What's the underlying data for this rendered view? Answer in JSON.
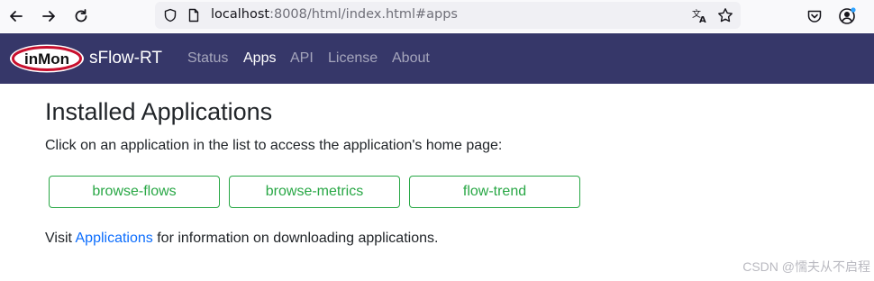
{
  "browser": {
    "url_host": "localhost",
    "url_rest": ":8008/html/index.html#apps",
    "icons": [
      "back-arrow-icon",
      "forward-arrow-icon",
      "reload-icon",
      "shield-icon",
      "page-icon",
      "translate-icon",
      "star-icon",
      "pocket-icon",
      "account-icon"
    ]
  },
  "navbar": {
    "logo_text": "inMon",
    "brand": "sFlow-RT",
    "links": [
      "Status",
      "Apps",
      "API",
      "License",
      "About"
    ],
    "active": "Apps",
    "bg_color": "#363769"
  },
  "main": {
    "title": "Installed Applications",
    "intro": "Click on an application in the list to access the application's home page:",
    "apps": [
      "browse-flows",
      "browse-metrics",
      "flow-trend"
    ],
    "visit_prefix": "Visit",
    "visit_link": "Applications",
    "visit_suffix": "for information on downloading applications."
  },
  "watermark": "CSDN @懦夫从不启程",
  "colors": {
    "accent_green": "#28a745",
    "link_blue": "#0d6efd"
  }
}
